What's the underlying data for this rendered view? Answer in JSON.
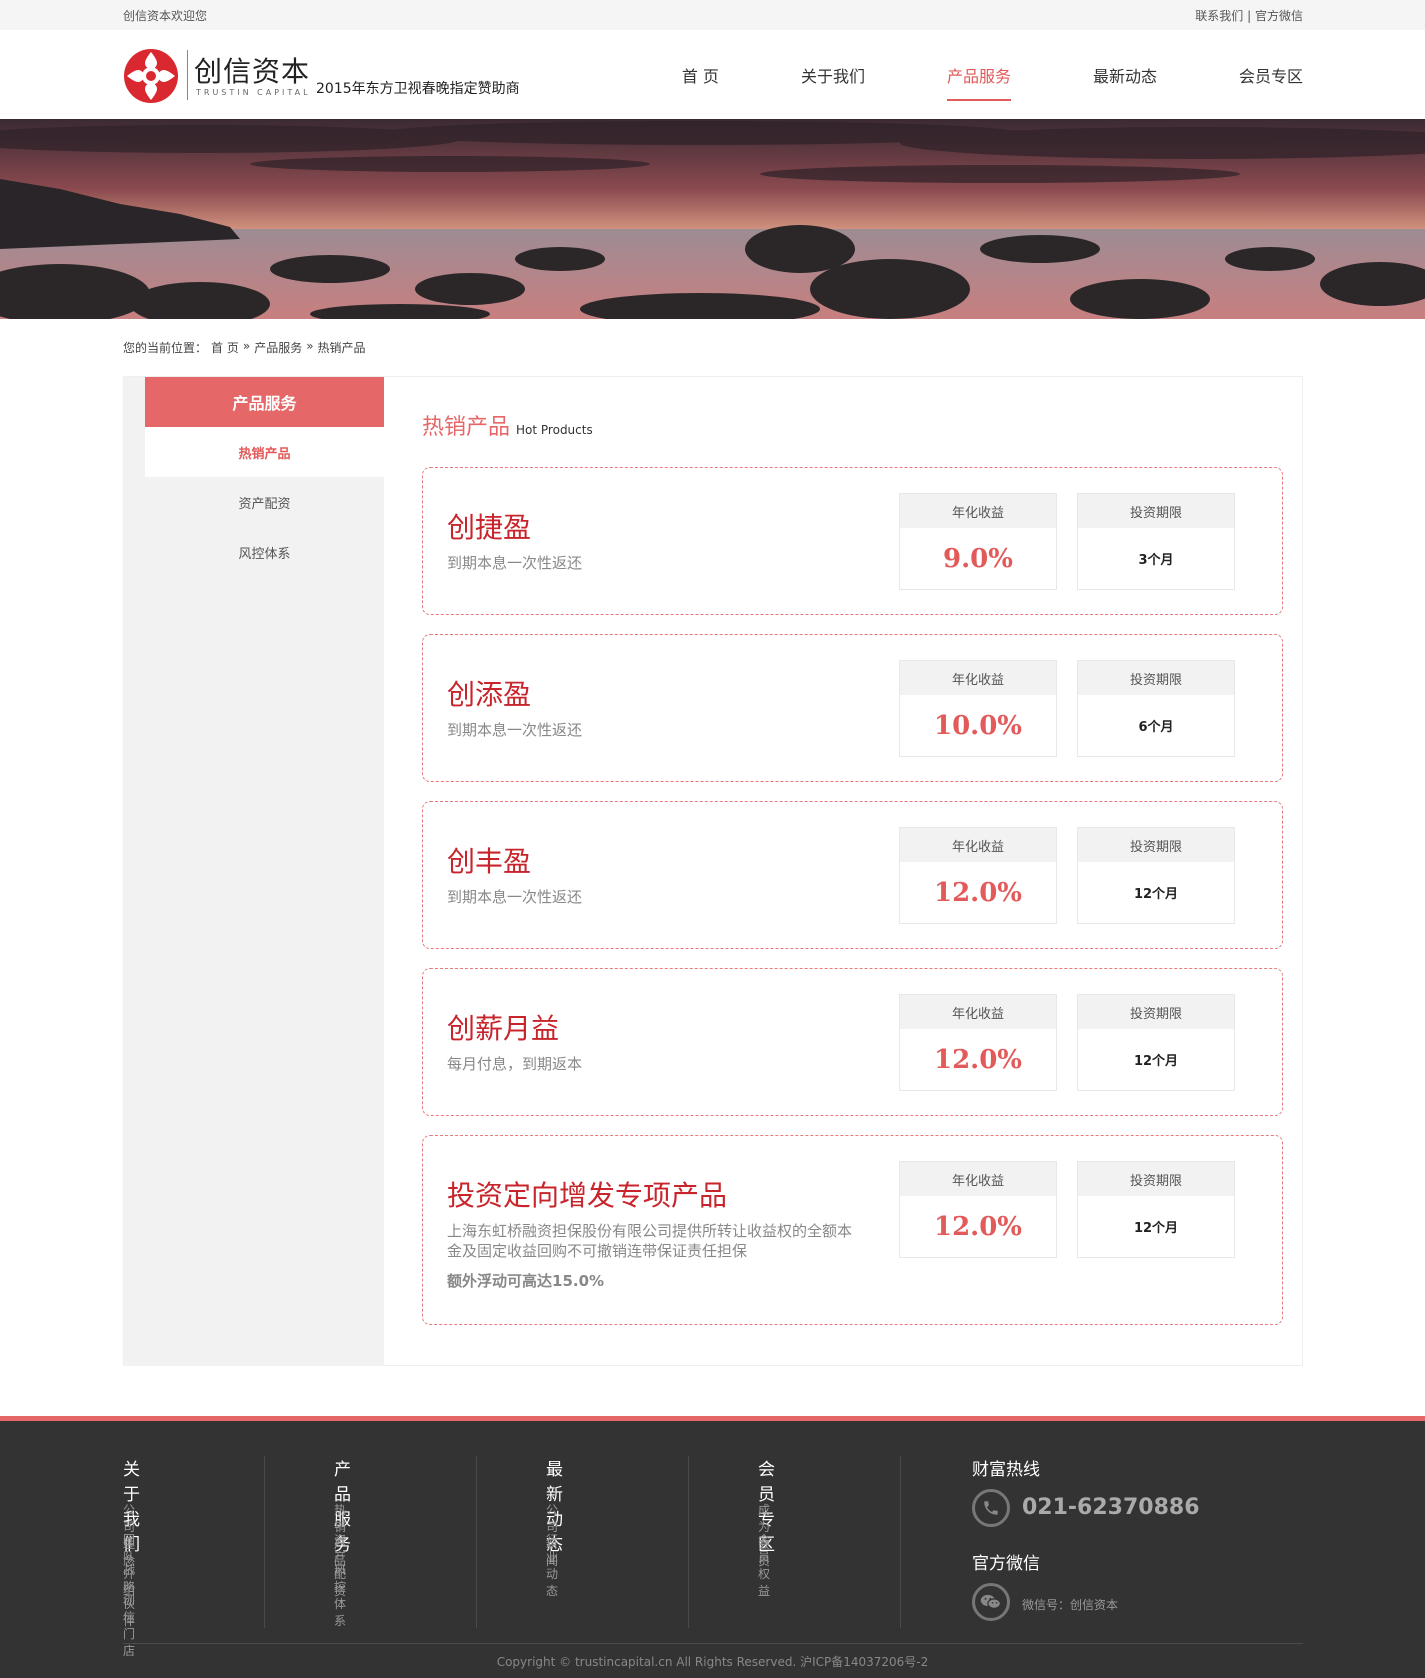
{
  "topbar": {
    "welcome": "创信资本欢迎您",
    "contact": "联系我们",
    "sep": "|",
    "wechat": "官方微信"
  },
  "header": {
    "logo_cn": "创信资本",
    "logo_en": "TRUSTIN CAPITAL",
    "slogan": "2015年东方卫视春晚指定赞助商",
    "nav": [
      "首 页",
      "关于我们",
      "产品服务",
      "最新动态",
      "会员专区"
    ],
    "nav_active": 2
  },
  "breadcrumb": {
    "prefix": "您的当前位置：",
    "items": [
      "首 页",
      "»",
      "产品服务",
      "»",
      "热销产品"
    ]
  },
  "sidebar": {
    "title": "产品服务",
    "items": [
      "热销产品",
      "资产配资",
      "风控体系"
    ],
    "active": 0
  },
  "content": {
    "title_cn": "热销产品",
    "title_en": "Hot Products",
    "rate_label": "年化收益",
    "term_label": "投资期限",
    "products": [
      {
        "name": "创捷盈",
        "desc": "到期本息一次性返还",
        "rate": "9.0%",
        "term": "3个月"
      },
      {
        "name": "创添盈",
        "desc": "到期本息一次性返还",
        "rate": "10.0%",
        "term": "6个月"
      },
      {
        "name": "创丰盈",
        "desc": "到期本息一次性返还",
        "rate": "12.0%",
        "term": "12个月"
      },
      {
        "name": "创薪月益",
        "desc": "每月付息，到期返本",
        "rate": "12.0%",
        "term": "12个月"
      },
      {
        "name": "投资定向增发专项产品",
        "desc": "上海东虹桥融资担保股份有限公司提供所转让收益权的全额本金及固定收益回购不可撤销连带保证责任担保",
        "extra": "额外浮动可高达15.0%",
        "rate": "12.0%",
        "term": "12个月"
      }
    ]
  },
  "footer": {
    "cols": [
      {
        "title": "关于我们",
        "links": [
          "公司理念",
          "团队介绍",
          "战略伙伴",
          "创信门店"
        ]
      },
      {
        "title": "产品服务",
        "links": [
          "热销产品",
          "资产配资",
          "风控体系"
        ]
      },
      {
        "title": "最新动态",
        "links": [
          "公司新闻",
          "行业动态"
        ]
      },
      {
        "title": "会员专区",
        "links": [
          "成为会员",
          "会员权益"
        ]
      }
    ],
    "hotline_title": "财富热线",
    "hotline": "021-62370886",
    "wechat_title": "官方微信",
    "wechat_id": "微信号：创信资本",
    "copyright": "Copyright © trustincapital.cn All Rights Reserved. 沪ICP备14037206号-2"
  },
  "colors": {
    "accent": "#e66767",
    "product_name": "#c8242b",
    "footer_bg": "#333333"
  },
  "icons": [
    "logo-mark-icon",
    "phone-icon",
    "wechat-icon"
  ]
}
